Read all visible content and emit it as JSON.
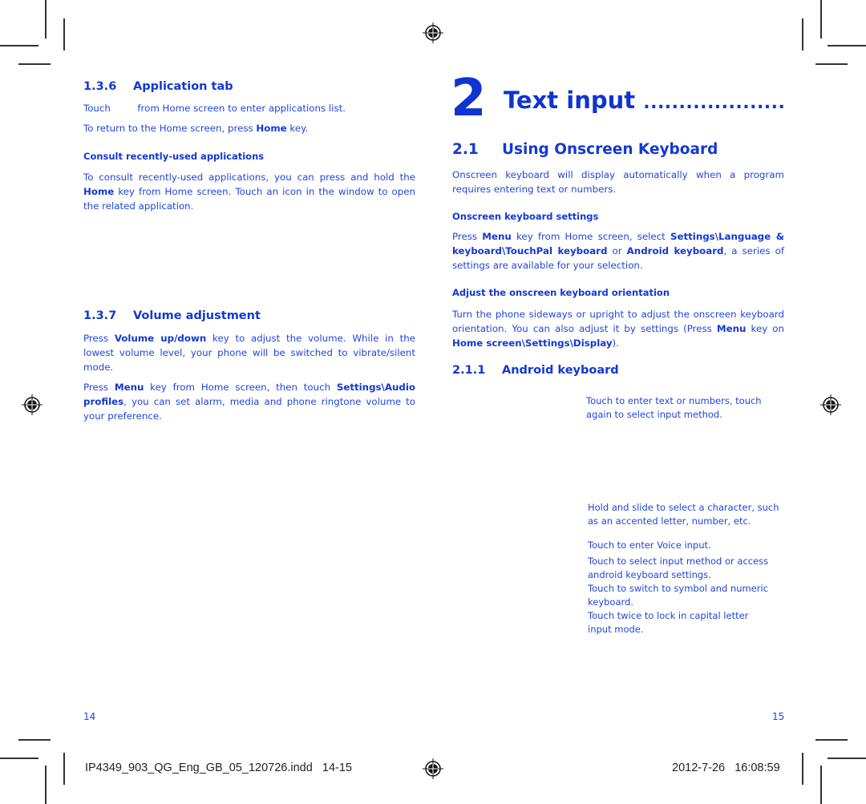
{
  "left_page": {
    "section_136": {
      "number": "1.3.6",
      "title": "Application tab",
      "touch_word": "Touch",
      "touch_rest": "from Home screen to enter applications list.",
      "return_pre": "To return to the Home screen, press ",
      "return_bold": "Home",
      "return_post": " key.",
      "sub_title": "Consult recently-used applications",
      "consult_pre": "To consult recently-used applications, you can press and hold the ",
      "consult_bold": "Home",
      "consult_post": " key from Home screen. Touch an icon in the window to open the related application."
    },
    "section_137": {
      "number": "1.3.7",
      "title": "Volume adjustment",
      "p1_pre": "Press ",
      "p1_bold": "Volume up/down",
      "p1_post": " key to adjust the volume. While in the lowest volume level, your phone will be switched to vibrate/silent mode.",
      "p2_pre": "Press ",
      "p2_bold1": "Menu",
      "p2_mid": " key from Home screen, then touch ",
      "p2_bold2": "Settings\\Audio profiles",
      "p2_post": ", you can set alarm, media and phone ringtone volume to your preference."
    },
    "page_number": "14"
  },
  "right_page": {
    "chapter_number": "2",
    "chapter_title": "Text input",
    "chapter_leader": "....................",
    "section_21": {
      "number": "2.1",
      "title": "Using Onscreen Keyboard",
      "intro": "Onscreen keyboard will display automatically when a program requires entering text or numbers.",
      "settings_title": "Onscreen keyboard settings",
      "settings_pre": "Press ",
      "settings_b1": "Menu",
      "settings_m1": " key from Home screen, select ",
      "settings_b2": "Settings\\Language & keyboard\\TouchPal keyboard",
      "settings_m2": " or ",
      "settings_b3": "Android keyboard",
      "settings_post": ", a series of settings are available for your selection.",
      "orient_title": "Adjust the onscreen keyboard orientation",
      "orient_pre": "Turn the phone sideways or upright to adjust the onscreen keyboard orientation. You can also adjust it by settings (Press ",
      "orient_b1": "Menu",
      "orient_m1": " key on ",
      "orient_b2": "Home screen\\Settings\\Display",
      "orient_post": ")."
    },
    "section_211": {
      "number": "2.1.1",
      "title": "Android keyboard",
      "callouts": [
        "Touch to enter text or numbers, touch again to select input method.",
        "Hold and slide to select a character, such as an accented letter, number, etc.",
        "Touch to enter Voice input.",
        "Touch to select input method or access android keyboard settings.",
        "Touch to switch to symbol and numeric keyboard.",
        "Touch twice to lock in capital letter input mode."
      ]
    },
    "page_number": "15"
  },
  "slug": {
    "filename": "IP4349_903_QG_Eng_GB_05_120726.indd   14-15",
    "timestamp": "2012-7-26   16:08:59"
  },
  "colors": {
    "text_blue": "#1f46dc",
    "heading_blue": "#1238d4",
    "marks": "#333333"
  }
}
